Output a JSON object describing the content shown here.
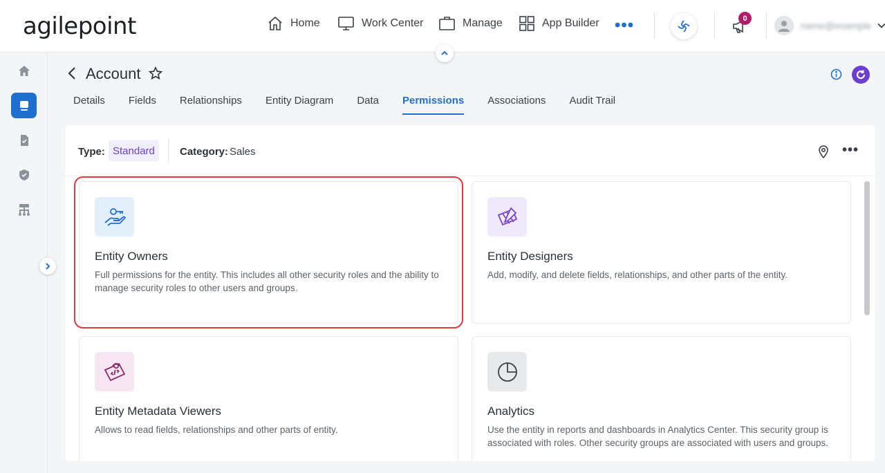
{
  "app": {
    "logo_text": "agilepoint"
  },
  "top_nav": {
    "home": "Home",
    "work_center": "Work Center",
    "manage": "Manage",
    "app_builder": "App Builder",
    "notification_count": "0",
    "user_name": "name@example"
  },
  "header": {
    "title": "Account"
  },
  "tabs": [
    {
      "label": "Details"
    },
    {
      "label": "Fields"
    },
    {
      "label": "Relationships"
    },
    {
      "label": "Entity Diagram"
    },
    {
      "label": "Data"
    },
    {
      "label": "Permissions",
      "active": true
    },
    {
      "label": "Associations"
    },
    {
      "label": "Audit Trail"
    }
  ],
  "panel": {
    "type_label": "Type:",
    "type_value": "Standard",
    "category_label": "Category:",
    "category_value": "Sales"
  },
  "cards": [
    {
      "title": "Entity Owners",
      "description": "Full permissions for the entity. This includes all other security roles and the ability to manage security roles to other users and groups.",
      "icon": "key-hand-icon",
      "selected": true
    },
    {
      "title": "Entity Designers",
      "description": "Add, modify, and delete fields, relationships, and other parts of the entity.",
      "icon": "design-tools-icon"
    },
    {
      "title": "Entity Metadata Viewers",
      "description": "Allows to read fields, relationships and other parts of entity.",
      "icon": "code-view-icon"
    },
    {
      "title": "Analytics",
      "description": "Use the entity in reports and dashboards in Analytics Center. This security group is associated with roles. Other security groups are associated with users and groups.",
      "icon": "pie-chart-icon"
    }
  ],
  "colors": {
    "accent": "#1f6fd1",
    "purple": "#6c3fd1",
    "selection": "#e0393e",
    "badge": "#b01e6b"
  }
}
